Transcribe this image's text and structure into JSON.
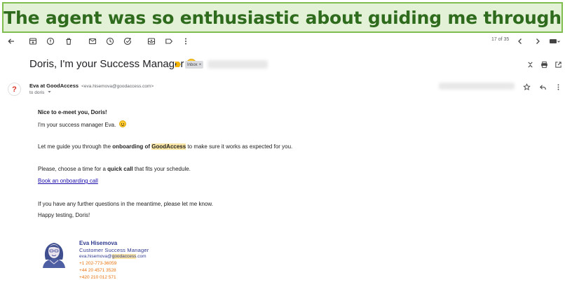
{
  "banner": {
    "text": "The agent was so enthusiastic about guiding me through"
  },
  "toolbar": {
    "pager": "17 of 35",
    "icons": [
      "back-arrow-icon",
      "archive-icon",
      "report-spam-icon",
      "delete-icon",
      "mark-unread-icon",
      "snooze-icon",
      "add-task-icon",
      "move-to-icon",
      "label-icon",
      "more-icon",
      "newer-icon",
      "older-icon",
      "keyboard-icon"
    ]
  },
  "email": {
    "subject": "Doris, I'm your Success Manager",
    "label": "Inbox",
    "label_close": "×",
    "sender": {
      "avatar_glyph": "?",
      "name": "Eva at GoodAccess",
      "email": "<eva.hisemova@goodaccess.com>",
      "to": "to doris"
    },
    "body": {
      "greeting": "Nice to e-meet you, Doris!",
      "intro": "I'm your success manager Eva.",
      "p1_before": "Let me guide you through the ",
      "p1_bold": "onboarding of ",
      "p1_bold_hl": "GoodAccess",
      "p1_after": " to make sure it works as expected for you.",
      "p2_before": "Please, choose a time for a ",
      "p2_bold": "quick call",
      "p2_after": " that fits your schedule.",
      "link": "Book an onboarding call",
      "p3": "If you have any further questions in the meantime, please let me know.",
      "closing": "Happy testing, Doris!"
    },
    "signature": {
      "name": "Eva Hisemova",
      "title": "Customer Success Manager",
      "email_user": "eva.hisemova@",
      "email_domain_hl": "goodaccess",
      "email_tld": ".com",
      "phone1": "+1 202-773-36059",
      "phone2": "+44 20 4571 3528",
      "phone3": "+420 210 012 571"
    }
  },
  "colors": {
    "banner_bg": "#e3f1d6",
    "banner_border": "#7fbd4f",
    "banner_text": "#2e6b1d",
    "signature_blue": "#2f3a8f",
    "signature_orange": "#e8710a",
    "highlight": "#fce8a6"
  }
}
